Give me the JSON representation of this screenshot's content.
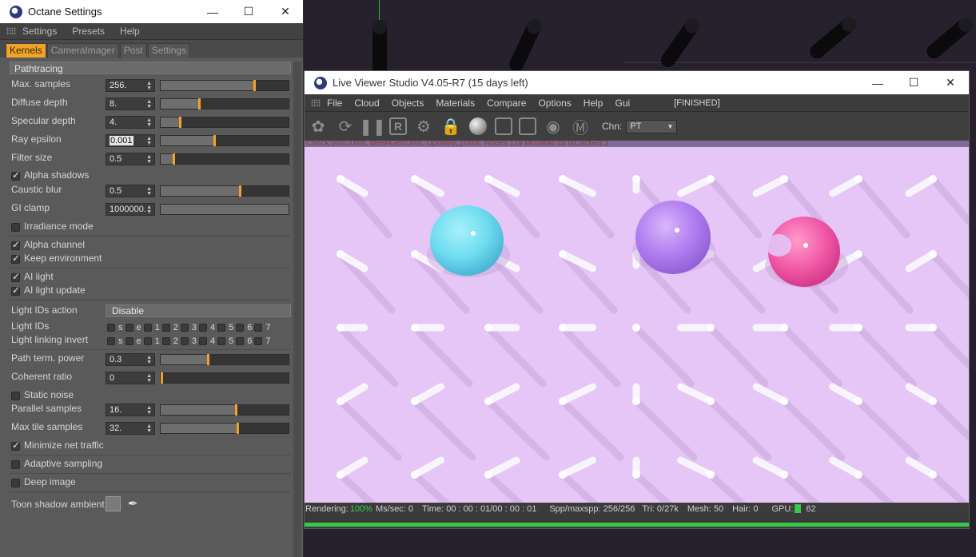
{
  "octane": {
    "title": "Octane Settings",
    "menu": [
      "Settings",
      "Presets",
      "Help"
    ],
    "tabs": [
      {
        "label": "Kernels",
        "active": true
      },
      {
        "label": "CameraImager",
        "active": false
      },
      {
        "label": "Post",
        "active": false
      },
      {
        "label": "Settings",
        "active": false
      }
    ],
    "section": "Pathtracing",
    "params": {
      "max_samples": {
        "label": "Max. samples",
        "value": "256.",
        "level": 0.73
      },
      "diffuse_depth": {
        "label": "Diffuse depth",
        "value": "8.",
        "level": 0.3
      },
      "specular_depth": {
        "label": "Specular depth",
        "value": "4.",
        "level": 0.15
      },
      "ray_epsilon": {
        "label": "Ray epsilon",
        "value": "0.001",
        "level": 0.42
      },
      "filter_size": {
        "label": "Filter size",
        "value": "0.5",
        "level": 0.1
      },
      "alpha_shadows": {
        "label": "Alpha shadows",
        "checked": true
      },
      "caustic_blur": {
        "label": "Caustic blur",
        "value": "0.5",
        "level": 0.62
      },
      "gi_clamp": {
        "label": "GI clamp",
        "value": "1000000.",
        "level": 1.0
      },
      "irradiance_mode": {
        "label": "Irradiance mode",
        "checked": false
      },
      "alpha_channel": {
        "label": "Alpha channel",
        "checked": true
      },
      "keep_environment": {
        "label": "Keep environment",
        "checked": true
      },
      "ai_light": {
        "label": "AI light",
        "checked": true
      },
      "ai_light_update": {
        "label": "AI light update",
        "checked": true
      },
      "light_ids_action": {
        "label": "Light IDs action",
        "value": "Disable"
      },
      "light_ids": {
        "label": "Light IDs",
        "items": [
          "s",
          "e",
          "1",
          "2",
          "3",
          "4",
          "5",
          "6",
          "7"
        ]
      },
      "light_linking_invert": {
        "label": "Light linking invert",
        "items": [
          "s",
          "e",
          "1",
          "2",
          "3",
          "4",
          "5",
          "6",
          "7"
        ]
      },
      "path_term_power": {
        "label": "Path term. power",
        "value": "0.3",
        "level": 0.37
      },
      "coherent_ratio": {
        "label": "Coherent ratio",
        "value": "0",
        "level": 0.0
      },
      "static_noise": {
        "label": "Static noise",
        "checked": false
      },
      "parallel_samples": {
        "label": "Parallel samples",
        "value": "16.",
        "level": 0.59
      },
      "max_tile_samples": {
        "label": "Max tile samples",
        "value": "32.",
        "level": 0.6
      },
      "minimize_net_traffic": {
        "label": "Minimize net traffic",
        "checked": true
      },
      "adaptive_sampling": {
        "label": "Adaptive sampling",
        "checked": false
      },
      "deep_image": {
        "label": "Deep image",
        "checked": false
      },
      "toon_shadow_ambient": {
        "label": "Toon shadow ambient"
      }
    }
  },
  "viewer": {
    "title": "Live Viewer Studio V4.05-R7 (15 days left)",
    "menu": [
      "File",
      "Cloud",
      "Objects",
      "Materials",
      "Compare",
      "Options",
      "Help",
      "Gui"
    ],
    "state": "[FINISHED]",
    "toolbar_icons": [
      "restart-render-icon",
      "refresh-icon",
      "pause-icon",
      "region-render-icon",
      "settings-gear-icon",
      "lock-icon",
      "material-ball-icon",
      "film-region-icon",
      "clay-mode-icon",
      "focus-picker-icon",
      "material-picker-icon"
    ],
    "channel_label": "Chn:",
    "channel_value": "PT",
    "status_strip": "Check:0ms./0ms. MeshGen:0ms. Update[C]:0ms. Nodes:119 Movable:49 txCached:3",
    "render_status": {
      "rendering": "Rendering:",
      "rendering_pct": "100%",
      "ms_sec": "Ms/sec: 0",
      "time": "Time: 00 : 00 : 01/00 : 00 : 01",
      "spp": "Spp/maxspp: 256/256",
      "tri": "Tri: 0/27k",
      "mesh": "Mesh: 50",
      "hair": "Hair: 0",
      "gpu": "GPU:",
      "gpu_temp": "62"
    },
    "progress": 1.0,
    "colors": {
      "background": "#e5c6f7",
      "ball_cyan": "#6fdcf0",
      "ball_violet": "#b07ef0",
      "ball_pink": "#f25aa8"
    }
  }
}
